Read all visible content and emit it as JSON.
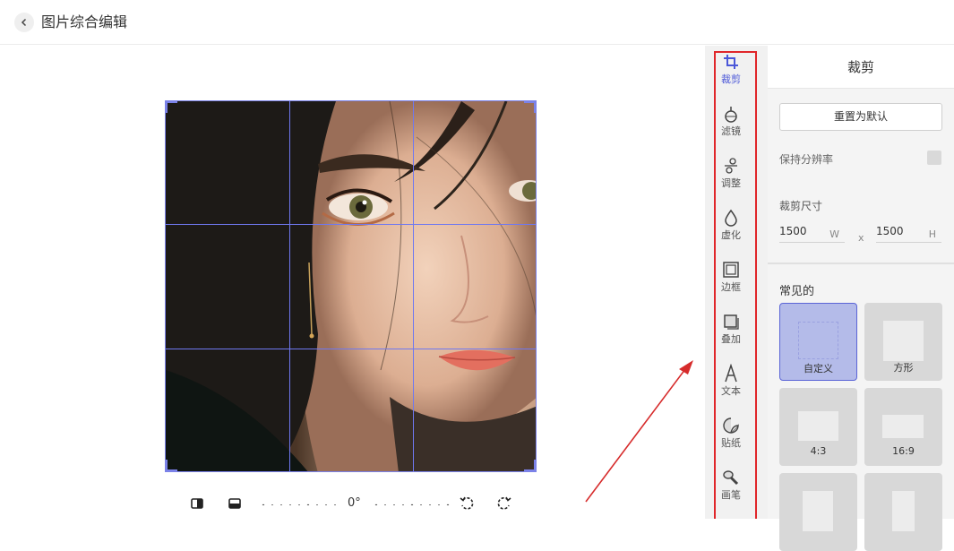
{
  "header": {
    "back_icon": "chevron-left-icon",
    "title": "图片综合编辑"
  },
  "editor": {
    "rotation_angle": "0°"
  },
  "toolbar_icons": [
    "flip-horizontal-icon",
    "flip-vertical-icon",
    "rotate-left-icon",
    "rotate-right-icon"
  ],
  "sidebar": {
    "items": [
      {
        "label": "裁剪",
        "icon": "crop-icon",
        "active": true
      },
      {
        "label": "滤镜",
        "icon": "flask-icon"
      },
      {
        "label": "调整",
        "icon": "adjust-icon"
      },
      {
        "label": "虚化",
        "icon": "drop-icon"
      },
      {
        "label": "边框",
        "icon": "frame-icon"
      },
      {
        "label": "叠加",
        "icon": "overlay-icon"
      },
      {
        "label": "文本",
        "icon": "text-icon"
      },
      {
        "label": "贴纸",
        "icon": "sticker-icon"
      },
      {
        "label": "画笔",
        "icon": "brush-icon"
      }
    ]
  },
  "panel": {
    "title": "裁剪",
    "reset_label": "重置为默认",
    "keep_resolution_label": "保持分辨率",
    "crop_size_label": "裁剪尺寸",
    "width_value": "1500",
    "width_unit": "W",
    "separator": "x",
    "height_value": "1500",
    "height_unit": "H",
    "common_label": "常见的",
    "presets": [
      {
        "label": "自定义",
        "selected": true
      },
      {
        "label": "方形"
      },
      {
        "label": "4:3"
      },
      {
        "label": "16:9"
      },
      {
        "label": ""
      },
      {
        "label": ""
      }
    ]
  },
  "colors": {
    "accent": "#4b57d8",
    "highlight_outline": "#e0262a",
    "crop_grid": "#6f78f0"
  }
}
